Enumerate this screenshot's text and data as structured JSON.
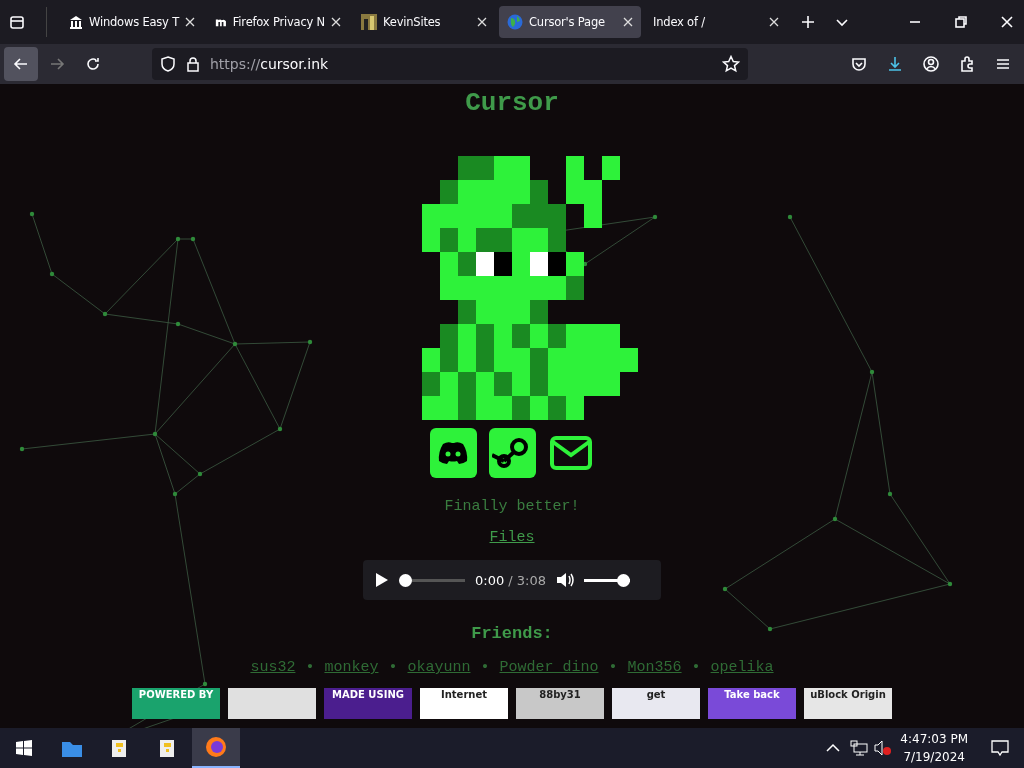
{
  "browser": {
    "tabs": [
      {
        "title": "Windows Easy T",
        "selected": false
      },
      {
        "title": "Firefox Privacy N",
        "selected": false
      },
      {
        "title": "KevinSites",
        "selected": false
      },
      {
        "title": "Cursor's Page",
        "selected": true
      },
      {
        "title": "Index of /",
        "selected": false
      }
    ],
    "url_scheme": "https://",
    "url_host": "cursor.ink"
  },
  "page": {
    "title": "Cursor",
    "status": "Finally better!",
    "files_link": "Files",
    "audio": {
      "seek": {
        "level": 0
      },
      "current": "0:00",
      "duration": "/ 3:08",
      "volume": {
        "level": 1
      }
    },
    "friends_heading": "Friends:",
    "friends": [
      "sus32",
      "monkey",
      "okayunn",
      "Powder dino",
      "Mon356",
      "opelika"
    ],
    "separator": "•",
    "badges": [
      {
        "text": "POWERED BY",
        "color": "#1aa36d"
      },
      {
        "color": "#e0e0e0"
      },
      {
        "text": "MADE USING",
        "color": "#4b1e8e"
      },
      {
        "text": "Internet",
        "color": "#ffffff"
      },
      {
        "text": "88by31",
        "color": "#c8c8c8"
      },
      {
        "text": "get",
        "color": "#e8e8f0"
      },
      {
        "text": "Take back",
        "color": "#7a4ad8"
      },
      {
        "text": "uBlock Origin",
        "color": "#e6e6e6"
      }
    ]
  },
  "taskbar": {
    "time": "4:47:03 PM",
    "date": "7/19/2024"
  }
}
